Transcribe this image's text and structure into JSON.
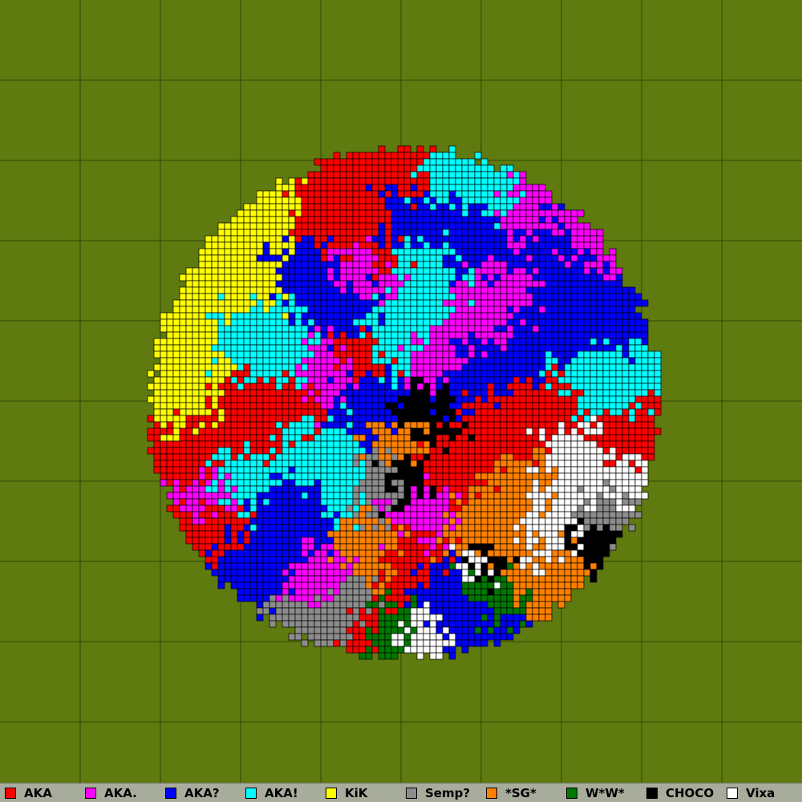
{
  "map": {
    "background_color": "#5f7a0e",
    "grid_color": "#2f4a08",
    "grid_columns": 10,
    "grid_rows": 10
  },
  "legend": {
    "items": [
      {
        "label": "AKA",
        "color": "#ff0000"
      },
      {
        "label": "AKA.",
        "color": "#ff00ff"
      },
      {
        "label": "AKA?",
        "color": "#0000ff"
      },
      {
        "label": "AKA!",
        "color": "#00ffff"
      },
      {
        "label": "KiK",
        "color": "#ffff00"
      },
      {
        "label": "Semp?",
        "color": "#8c8c8c"
      },
      {
        "label": "*SG*",
        "color": "#ff8000"
      },
      {
        "label": "W*W*",
        "color": "#007800"
      },
      {
        "label": "CHOCO",
        "color": "#000000"
      },
      {
        "label": "Vixa",
        "color": "#ffffff"
      }
    ]
  }
}
